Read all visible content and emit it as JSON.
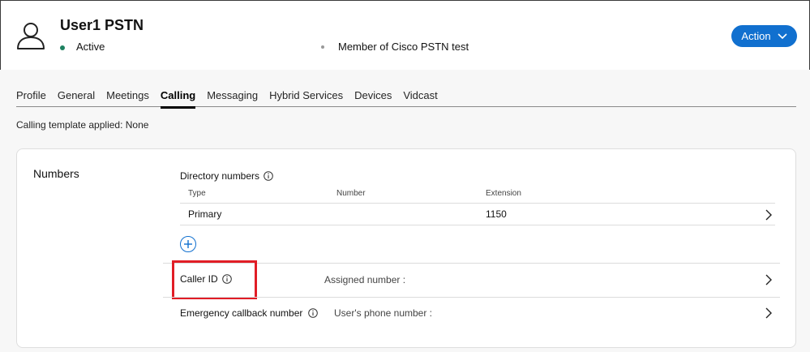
{
  "user": {
    "name": "User1 PSTN",
    "status": "Active",
    "membership": "Member of Cisco PSTN test"
  },
  "action_button": {
    "label": "Action"
  },
  "tabs": [
    {
      "label": "Profile"
    },
    {
      "label": "General"
    },
    {
      "label": "Meetings"
    },
    {
      "label": "Calling",
      "active": true
    },
    {
      "label": "Messaging"
    },
    {
      "label": "Hybrid Services"
    },
    {
      "label": "Devices"
    },
    {
      "label": "Vidcast"
    }
  ],
  "template": {
    "label": "Calling template applied:",
    "value": "None"
  },
  "numbers": {
    "title": "Numbers",
    "directory": {
      "title": "Directory numbers",
      "columns": [
        "Type",
        "Number",
        "Extension"
      ],
      "rows": [
        {
          "type": "Primary",
          "number": "",
          "extension": "1150"
        }
      ]
    },
    "caller_id": {
      "label": "Caller ID",
      "value": "Assigned number :"
    },
    "emergency": {
      "label": "Emergency callback number",
      "value": "User's phone number :"
    }
  },
  "colors": {
    "accent": "#1170cf",
    "status_active": "#1d8160",
    "highlight": "#e11d26"
  },
  "icons": [
    "user-avatar-icon",
    "chevron-down-icon",
    "info-icon",
    "plus-icon",
    "chevron-right-icon"
  ]
}
